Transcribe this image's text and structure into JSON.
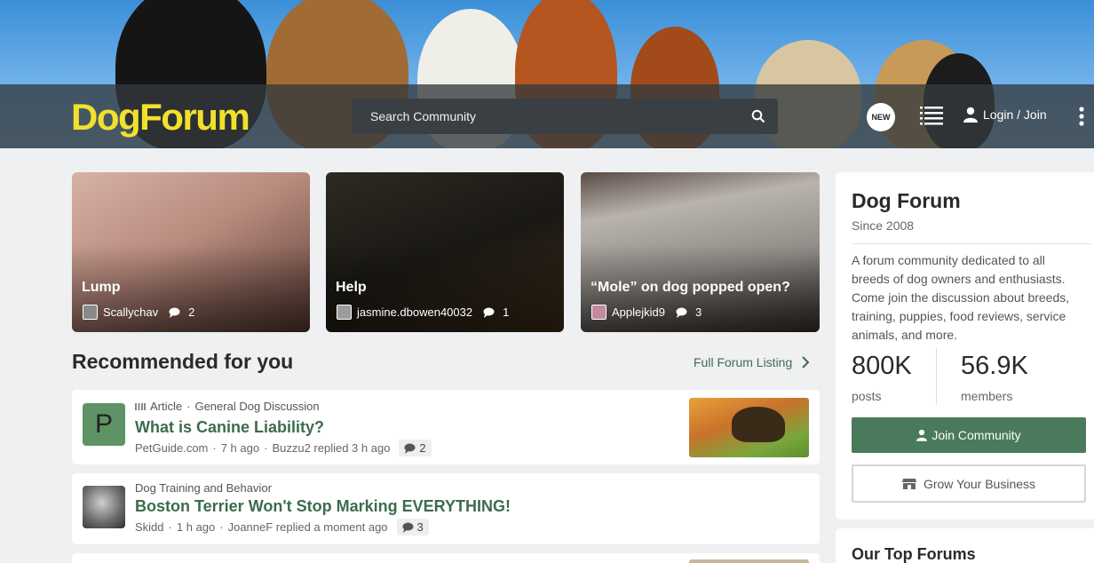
{
  "header": {
    "logo": "DogForum",
    "search_placeholder": "Search Community",
    "new_badge": "NEW",
    "login": "Login / Join"
  },
  "cards": [
    {
      "title": "Lump",
      "author": "Scallychav",
      "comments": "2"
    },
    {
      "title": "Help",
      "author": "jasmine.dbowen40032",
      "comments": "1"
    },
    {
      "title": "“Mole” on dog popped open?",
      "author": "Applejkid9",
      "comments": "3"
    }
  ],
  "recommended": {
    "heading": "Recommended for you",
    "full_listing": "Full Forum Listing",
    "items": [
      {
        "avatar_letter": "P",
        "type": "Article",
        "forum": "General Dog Discussion",
        "title": "What is Canine Liability?",
        "source": "PetGuide.com",
        "age": "7 h ago",
        "reply": "Buzzu2 replied 3 h ago",
        "comments": "2"
      },
      {
        "forum": "Dog Training and Behavior",
        "title": "Boston Terrier Won't Stop Marking EVERYTHING!",
        "source": "Skidd",
        "age": "1 h ago",
        "reply": "JoanneF replied a moment ago",
        "comments": "3"
      }
    ]
  },
  "sidebar": {
    "title": "Dog Forum",
    "since": "Since 2008",
    "description": "A forum community dedicated to all breeds of dog owners and enthusiasts. Come join the discussion about breeds, training, puppies, food reviews, service animals, and more.",
    "posts_value": "800K",
    "posts_label": "posts",
    "members_value": "56.9K",
    "members_label": "members",
    "join_button": "Join Community",
    "grow_button": "Grow Your Business",
    "top_forums_title": "Our Top Forums"
  },
  "colors": {
    "accent": "#4a7a5c",
    "logo": "#f1e12c",
    "title_link": "#3d6b4f"
  }
}
